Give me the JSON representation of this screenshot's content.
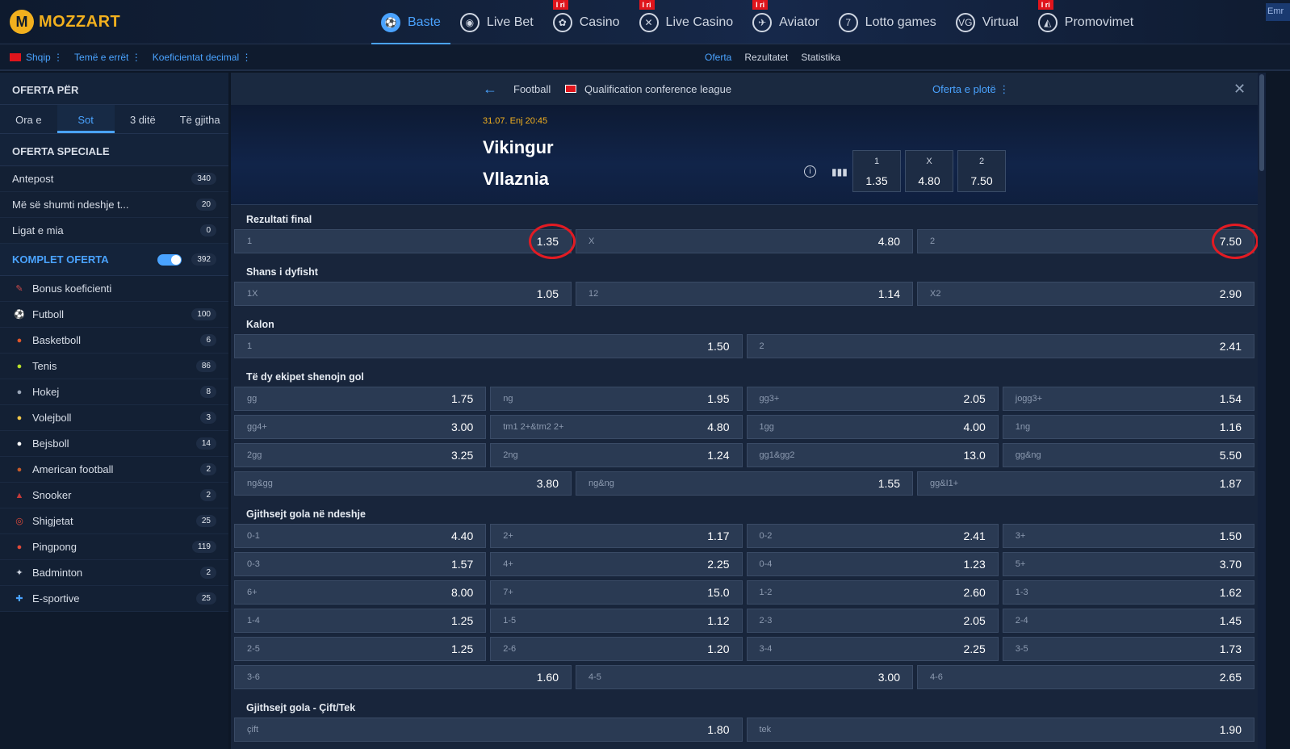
{
  "brand": {
    "name": "MOZZART",
    "mark": "M"
  },
  "nav": [
    {
      "label": "Baste",
      "icon": "football-icon",
      "glyph": "⚽",
      "active": true,
      "badge": ""
    },
    {
      "label": "Live Bet",
      "icon": "live-icon",
      "glyph": "◉",
      "badge": ""
    },
    {
      "label": "Casino",
      "icon": "cherry-icon",
      "glyph": "✿",
      "badge": "I ri"
    },
    {
      "label": "Live Casino",
      "icon": "chip-icon",
      "glyph": "✕",
      "badge": "I ri"
    },
    {
      "label": "Aviator",
      "icon": "plane-icon",
      "glyph": "✈",
      "badge": "I ri"
    },
    {
      "label": "Lotto games",
      "icon": "lotto-icon",
      "glyph": "7",
      "badge": ""
    },
    {
      "label": "Virtual",
      "icon": "virtual-icon",
      "glyph": "VG",
      "badge": ""
    },
    {
      "label": "Promovimet",
      "icon": "megaphone-icon",
      "glyph": "◭",
      "badge": "I ri"
    }
  ],
  "corner_label": "Emr",
  "subbar": {
    "language": "Shqip ⋮",
    "theme": "Temë e errët ⋮",
    "odds_format": "Koeficientat decimal ⋮",
    "tabs": [
      "Oferta",
      "Rezultatet",
      "Statistika"
    ]
  },
  "sidebar": {
    "offer_title": "OFERTA PËR",
    "time_tabs": [
      "Ora e",
      "Sot",
      "3 ditë",
      "Të gjitha"
    ],
    "special_title": "OFERTA SPECIALE",
    "special_items": [
      {
        "label": "Antepost",
        "count": "340"
      },
      {
        "label": "Më së shumti ndeshje t...",
        "count": "20"
      },
      {
        "label": "Ligat e mia",
        "count": "0"
      }
    ],
    "full_title": "KOMPLET OFERTA",
    "full_count": "392",
    "sports": [
      {
        "label": "Bonus koeficienti",
        "count": "",
        "icon": "bonus-icon",
        "glyph": "✎",
        "color": "#d24b4b"
      },
      {
        "label": "Futboll",
        "count": "100",
        "icon": "football-icon",
        "glyph": "⚽",
        "color": "#ffffff"
      },
      {
        "label": "Basketboll",
        "count": "6",
        "icon": "basketball-icon",
        "glyph": "●",
        "color": "#e0562a"
      },
      {
        "label": "Tenis",
        "count": "86",
        "icon": "tennis-icon",
        "glyph": "●",
        "color": "#b8e02a"
      },
      {
        "label": "Hokej",
        "count": "8",
        "icon": "hockey-icon",
        "glyph": "●",
        "color": "#9aa6b8"
      },
      {
        "label": "Volejboll",
        "count": "3",
        "icon": "volleyball-icon",
        "glyph": "●",
        "color": "#f2c84a"
      },
      {
        "label": "Bejsboll",
        "count": "14",
        "icon": "baseball-icon",
        "glyph": "●",
        "color": "#ffffff"
      },
      {
        "label": "American football",
        "count": "2",
        "icon": "american-football-icon",
        "glyph": "●",
        "color": "#c45a2a"
      },
      {
        "label": "Snooker",
        "count": "2",
        "icon": "snooker-icon",
        "glyph": "▲",
        "color": "#c43a3a"
      },
      {
        "label": "Shigjetat",
        "count": "25",
        "icon": "darts-icon",
        "glyph": "◎",
        "color": "#e04a3a"
      },
      {
        "label": "Pingpong",
        "count": "119",
        "icon": "pingpong-icon",
        "glyph": "●",
        "color": "#e04a3a"
      },
      {
        "label": "Badminton",
        "count": "2",
        "icon": "badminton-icon",
        "glyph": "✦",
        "color": "#cfd6e2"
      },
      {
        "label": "E-sportive",
        "count": "25",
        "icon": "gamepad-icon",
        "glyph": "✚",
        "color": "#4aa3ff"
      }
    ]
  },
  "crumb": {
    "sport": "Football",
    "league": "Qualification conference league",
    "full_offer": "Oferta e plotë ⋮"
  },
  "match": {
    "date": "31.07. Enj 20:45",
    "home": "Vikingur",
    "away": "Vllaznia",
    "odds": [
      {
        "label": "1",
        "value": "1.35"
      },
      {
        "label": "X",
        "value": "4.80"
      },
      {
        "label": "2",
        "value": "7.50"
      }
    ]
  },
  "markets": [
    {
      "title": "Rezultati final",
      "rows": [
        [
          {
            "l": "1",
            "v": "1.35",
            "ring": true
          },
          {
            "l": "X",
            "v": "4.80"
          },
          {
            "l": "2",
            "v": "7.50",
            "ring": true
          }
        ]
      ]
    },
    {
      "title": "Shans i dyfisht",
      "rows": [
        [
          {
            "l": "1X",
            "v": "1.05"
          },
          {
            "l": "12",
            "v": "1.14"
          },
          {
            "l": "X2",
            "v": "2.90"
          }
        ]
      ]
    },
    {
      "title": "Kalon",
      "rows": [
        [
          {
            "l": "1",
            "v": "1.50"
          },
          {
            "l": "2",
            "v": "2.41"
          }
        ]
      ]
    },
    {
      "title": "Të dy ekipet shenojn gol",
      "rows": [
        [
          {
            "l": "gg",
            "v": "1.75"
          },
          {
            "l": "ng",
            "v": "1.95"
          },
          {
            "l": "gg3+",
            "v": "2.05"
          },
          {
            "l": "jogg3+",
            "v": "1.54"
          }
        ],
        [
          {
            "l": "gg4+",
            "v": "3.00"
          },
          {
            "l": "tm1 2+&tm2 2+",
            "v": "4.80"
          },
          {
            "l": "1gg",
            "v": "4.00"
          },
          {
            "l": "1ng",
            "v": "1.16"
          }
        ],
        [
          {
            "l": "2gg",
            "v": "3.25"
          },
          {
            "l": "2ng",
            "v": "1.24"
          },
          {
            "l": "gg1&gg2",
            "v": "13.0"
          },
          {
            "l": "gg&ng",
            "v": "5.50"
          }
        ],
        [
          {
            "l": "ng&gg",
            "v": "3.80"
          },
          {
            "l": "ng&ng",
            "v": "1.55"
          },
          {
            "l": "gg&I1+",
            "v": "1.87"
          }
        ]
      ]
    },
    {
      "title": "Gjithsejt gola në ndeshje",
      "rows": [
        [
          {
            "l": "0-1",
            "v": "4.40"
          },
          {
            "l": "2+",
            "v": "1.17"
          },
          {
            "l": "0-2",
            "v": "2.41"
          },
          {
            "l": "3+",
            "v": "1.50"
          }
        ],
        [
          {
            "l": "0-3",
            "v": "1.57"
          },
          {
            "l": "4+",
            "v": "2.25"
          },
          {
            "l": "0-4",
            "v": "1.23"
          },
          {
            "l": "5+",
            "v": "3.70"
          }
        ],
        [
          {
            "l": "6+",
            "v": "8.00"
          },
          {
            "l": "7+",
            "v": "15.0"
          },
          {
            "l": "1-2",
            "v": "2.60"
          },
          {
            "l": "1-3",
            "v": "1.62"
          }
        ],
        [
          {
            "l": "1-4",
            "v": "1.25"
          },
          {
            "l": "1-5",
            "v": "1.12"
          },
          {
            "l": "2-3",
            "v": "2.05"
          },
          {
            "l": "2-4",
            "v": "1.45"
          }
        ],
        [
          {
            "l": "2-5",
            "v": "1.25"
          },
          {
            "l": "2-6",
            "v": "1.20"
          },
          {
            "l": "3-4",
            "v": "2.25"
          },
          {
            "l": "3-5",
            "v": "1.73"
          }
        ],
        [
          {
            "l": "3-6",
            "v": "1.60"
          },
          {
            "l": "4-5",
            "v": "3.00"
          },
          {
            "l": "4-6",
            "v": "2.65"
          }
        ]
      ]
    },
    {
      "title": "Gjithsejt gola - Çift/Tek",
      "rows": [
        [
          {
            "l": "çift",
            "v": "1.80"
          },
          {
            "l": "tek",
            "v": "1.90"
          }
        ]
      ]
    }
  ]
}
